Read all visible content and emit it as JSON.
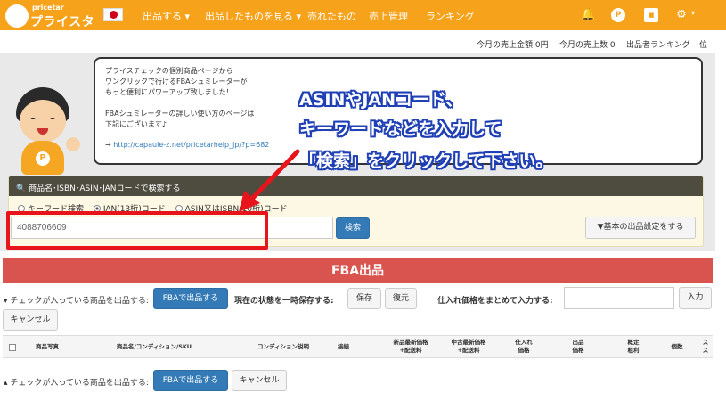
{
  "header": {
    "brand_small": "pricetar",
    "brand": "プライスター",
    "nav": [
      {
        "label": "出品する ▾"
      },
      {
        "label": "出品したものを見る ▾"
      },
      {
        "label": "売れたもの"
      },
      {
        "label": "売上管理"
      },
      {
        "label": "ランキング"
      }
    ],
    "icons": [
      "bell-icon",
      "profile-icon",
      "notice-icon",
      "gear-icon"
    ],
    "gear_caret": "▾"
  },
  "stats": {
    "sales_amount": "今月の売上金額 0円",
    "sales_count": "今月の売上数 0",
    "ranking": "出品者ランキング",
    "rank_suffix": "位"
  },
  "speech": {
    "lines": [
      "プライスチェックの個別商品ページから",
      "ワンクリックで行けるFBAシュミレーターが",
      "もっと便利にパワーアップ致しました！",
      "",
      "FBAシュミレーターの詳しい使い方のページは",
      "下記にございます♪",
      ""
    ],
    "link_prefix": "→ ",
    "link": "http://capaule-z.net/pricetarhelp_jp/?p=682"
  },
  "annotation": {
    "line1": "ASINやJANコード、",
    "line2": "キーワードなどを入力して",
    "line3": "「検索」をクリックして下さい。"
  },
  "search": {
    "heading": "商品名･ISBN･ASIN･JANコードで検索する",
    "options": [
      {
        "label": "キーワード検索",
        "selected": false
      },
      {
        "label": "JAN(13桁)コード",
        "selected": true
      },
      {
        "label": "ASIN又はISBN(10桁)コード",
        "selected": false
      }
    ],
    "input_value": "4088706609",
    "button": "検索",
    "settings_button": "▼基本の出品設定をする"
  },
  "fba": {
    "title": "FBA出品",
    "checked_label": "▾ チェックが入っている商品を出品する:",
    "fba_button": "FBAで出品する",
    "save_state_label": "現在の状態を一時保存する:",
    "save_button": "保存",
    "restore_button": "復元",
    "bulk_price_label": "仕入れ価格をまとめて入力する:",
    "input_button": "入力",
    "cancel_button": "キャンセル",
    "bottom_checked_label": "▴ チェックが入っている商品を出品する:",
    "bottom_fba_button": "FBAで出品する",
    "bottom_cancel_button": "キャンセル"
  },
  "table": {
    "columns": [
      {
        "l1": "商品写真",
        "l2": ""
      },
      {
        "l1": "商品名/コンディション/SKU",
        "l2": ""
      },
      {
        "l1": "コンディション説明",
        "l2": ""
      },
      {
        "l1": "接続",
        "l2": ""
      },
      {
        "l1": "新品最新価格",
        "l2": "+配送料"
      },
      {
        "l1": "中古最新価格",
        "l2": "+配送料"
      },
      {
        "l1": "仕入れ",
        "l2": "価格"
      },
      {
        "l1": "出品",
        "l2": "価格"
      },
      {
        "l1": "概定",
        "l2": "粗利"
      },
      {
        "l1": "個数",
        "l2": ""
      },
      {
        "l1": "ス",
        "l2": "ス"
      }
    ]
  }
}
